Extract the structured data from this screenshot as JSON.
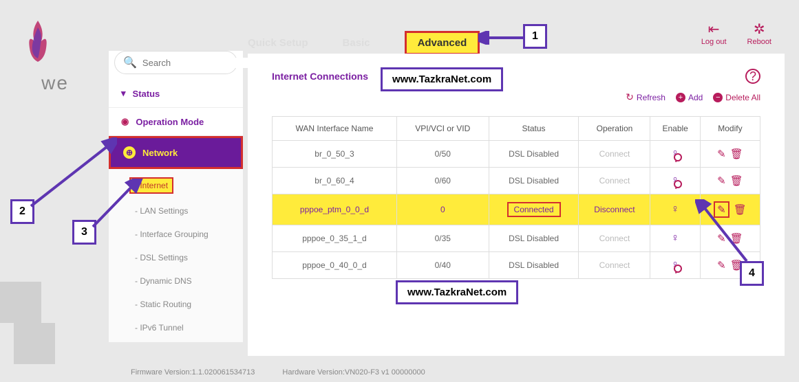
{
  "logo_text": "we",
  "search_placeholder": "Search",
  "sidebar": {
    "status": "Status",
    "opmode": "Operation Mode",
    "network": "Network",
    "subs": {
      "internet": "- Internet",
      "lan": "- LAN Settings",
      "grouping": "- Interface Grouping",
      "dsl": "- DSL Settings",
      "ddns": "- Dynamic DNS",
      "routing": "- Static Routing",
      "ipv6": "- IPv6 Tunnel"
    }
  },
  "tabs": {
    "quick": "Quick Setup",
    "basic": "Basic",
    "advanced": "Advanced"
  },
  "topact": {
    "logout": "Log out",
    "reboot": "Reboot"
  },
  "panel": {
    "title": "Internet Connections",
    "refresh": "Refresh",
    "add": "Add",
    "delall": "Delete All",
    "headers": {
      "name": "WAN Interface Name",
      "vpi": "VPI/VCI or VID",
      "status": "Status",
      "op": "Operation",
      "enable": "Enable",
      "modify": "Modify"
    }
  },
  "rows": [
    {
      "name": "br_0_50_3",
      "vpi": "0/50",
      "status": "DSL Disabled",
      "op": "Connect",
      "enabled": false,
      "highlight": false
    },
    {
      "name": "br_0_60_4",
      "vpi": "0/60",
      "status": "DSL Disabled",
      "op": "Connect",
      "enabled": false,
      "highlight": false
    },
    {
      "name": "pppoe_ptm_0_0_d",
      "vpi": "0",
      "status": "Connected",
      "op": "Disconnect",
      "enabled": true,
      "highlight": true
    },
    {
      "name": "pppoe_0_35_1_d",
      "vpi": "0/35",
      "status": "DSL Disabled",
      "op": "Connect",
      "enabled": true,
      "highlight": false
    },
    {
      "name": "pppoe_0_40_0_d",
      "vpi": "0/40",
      "status": "DSL Disabled",
      "op": "Connect",
      "enabled": false,
      "highlight": false
    }
  ],
  "footer": {
    "fw_label": "Firmware Version:",
    "fw": "1.1.020061534713",
    "hw_label": "Hardware Version:",
    "hw": "VN020-F3 v1 00000000"
  },
  "annotations": {
    "a1": "1",
    "a2": "2",
    "a3": "3",
    "a4": "4"
  },
  "watermark": "www.TazkraNet.com"
}
